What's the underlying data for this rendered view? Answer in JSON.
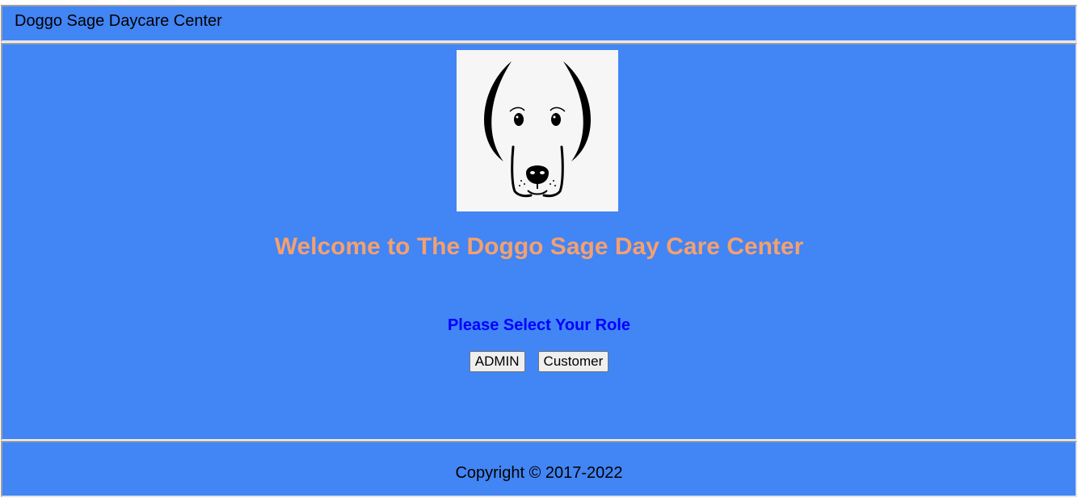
{
  "header": {
    "title": "Doggo Sage Daycare Center"
  },
  "main": {
    "logo_icon": "dog-face-icon",
    "welcome_text": "Welcome to The Doggo Sage Day Care Center",
    "role_prompt": "Please Select Your Role",
    "buttons": {
      "admin_label": "ADMIN",
      "customer_label": "Customer"
    }
  },
  "footer": {
    "copyright": "Copyright © 2017-2022"
  },
  "colors": {
    "background": "#4285f4",
    "welcome": "#f4a070",
    "role_prompt": "#0000ff",
    "logo_background": "#f6f6f6"
  }
}
